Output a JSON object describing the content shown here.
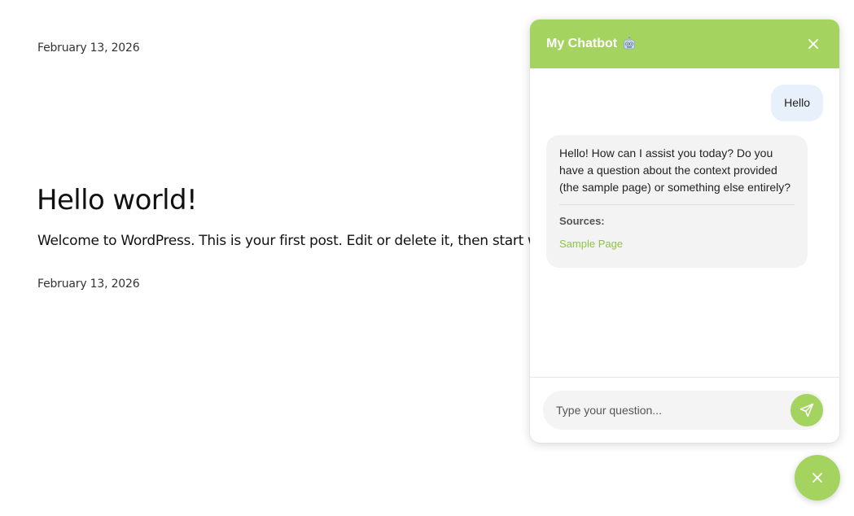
{
  "blog": {
    "date_top": "February 13, 2026",
    "post_title": "Hello world!",
    "post_excerpt": "Welcome to WordPress. This is your first post. Edit or delete it, then start writing!",
    "date_bottom": "February 13, 2026"
  },
  "chat": {
    "title": "My Chatbot",
    "header_icon": "robot-icon",
    "accent_color": "#a5d35f",
    "link_color": "#8cc63f",
    "messages": [
      {
        "role": "user",
        "text": "Hello"
      },
      {
        "role": "bot",
        "text": "Hello! How can I assist you today? Do you have a question about the context provided (the sample page) or something else entirely?",
        "sources_label": "Sources:",
        "sources": [
          "Sample Page"
        ]
      }
    ],
    "input_placeholder": "Type your question...",
    "input_value": ""
  }
}
